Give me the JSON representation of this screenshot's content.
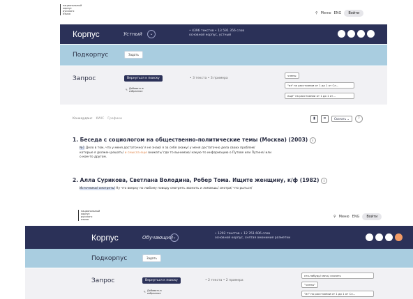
{
  "header1": {
    "logo_lines": [
      "национальный",
      "корпус",
      "русского",
      "языка"
    ],
    "menu_label": "Меню",
    "lang_label": "ENG",
    "login_label": "Войти"
  },
  "nav1": {
    "title": "Корпус",
    "subcorpus": "Устный",
    "stats_line1": "• 4396 текстов • 13 591 356 слов",
    "stats_line2": "основной корпус, устный"
  },
  "subbar1": {
    "title": "Подкорпус",
    "button": "Задать"
  },
  "req1": {
    "title": "Запрос",
    "back_button": "Вернуться к поиску",
    "add_label": "Добавить в избранное",
    "stats": "• 3 текста • 3 примера",
    "tags": [
      "члены",
      "\"из\" на расстоянии от 1 до 1 от Сл…",
      "еще\" на расстоянии от 1 до 1 от…"
    ]
  },
  "tabs": {
    "label": "Конкорданс",
    "t2": "KWIC",
    "t3": "Графики"
  },
  "sort_label": "Скачать",
  "results": [
    {
      "title": "1. Беседа с социологом на общественно-политические темы (Москва) (2003)",
      "tag": "№1",
      "line1": "Дело в том, что у меня достаточно/ я не знаю/ я за себя скажу/ у меня достаточно дела своих проблем/",
      "line2a": "которые я должен решать/",
      "line2hl": "и смысла еще",
      "line2b": "вникать/ где то вынимаю/ какую-то информацию о Путове или Путине/ или",
      "line3": "о ком-то другом."
    },
    {
      "title": "2. Алла Сурикова, Светлана Володина, Робер Тома. Ищите женщину, к/ф (1982)",
      "tag": "Источники/ смотреть/",
      "line1": "Ну что вверху по любому поводу смотреть звонить и ломаешь/ смотри/ что рыться/"
    }
  ],
  "header2": {
    "logo_lines": [
      "национальный",
      "корпус",
      "русского",
      "языка"
    ],
    "menu_label": "Меню",
    "lang_label": "ENG",
    "login_label": "Войти"
  },
  "nav2": {
    "title": "Корпус",
    "subcorpus": "Обучающий",
    "stats_line1": "• 1292 текстов • 12 761 606 слов",
    "stats_line2": "основной корпус, снятая омонимия разметки"
  },
  "subbar2": {
    "title": "Подкорпус",
    "button": "Задать"
  },
  "req2": {
    "title": "Запрос",
    "back_button": "Вернуться к поиску",
    "add_label": "Добавить в избранное",
    "stats": "• 2 текста • 2 примера",
    "tags": [
      "кто-нибудь/ мочь/ сказать",
      "\"члены\"",
      "\"из\" на расстоянии от 1 до 1 от Сл…"
    ]
  }
}
